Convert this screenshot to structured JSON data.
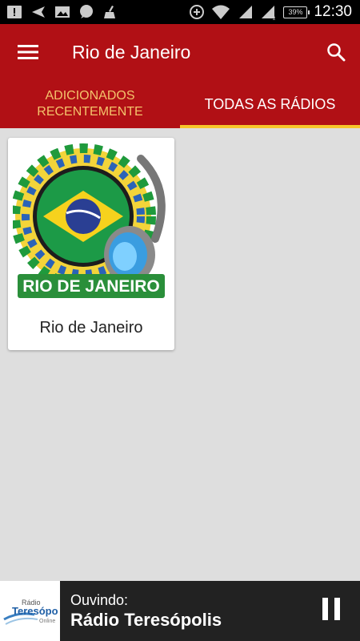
{
  "status_bar": {
    "time": "12:30",
    "battery": "39%"
  },
  "app_bar": {
    "title": "Rio de Janeiro"
  },
  "tabs": [
    {
      "line1": "ADICIONADOS",
      "line2": "RECENTEMENTE",
      "selected": false
    },
    {
      "label": "TODAS AS RÁDIOS",
      "selected": true
    }
  ],
  "cards": [
    {
      "label": "Rio de Janeiro",
      "banner": "RIO DE JANEIRO"
    }
  ],
  "player": {
    "label": "Ouvindo:",
    "station": "Rádio Teresópolis",
    "logo_line1": "Rádio",
    "logo_line2": "Teresópolis",
    "logo_line3": "Online"
  },
  "colors": {
    "primary": "#b11015",
    "indicator": "#f7c52a",
    "tab_inactive": "#f4c36b",
    "player_bg": "#222222"
  },
  "icons": [
    "menu-icon",
    "search-icon",
    "pause-icon"
  ]
}
